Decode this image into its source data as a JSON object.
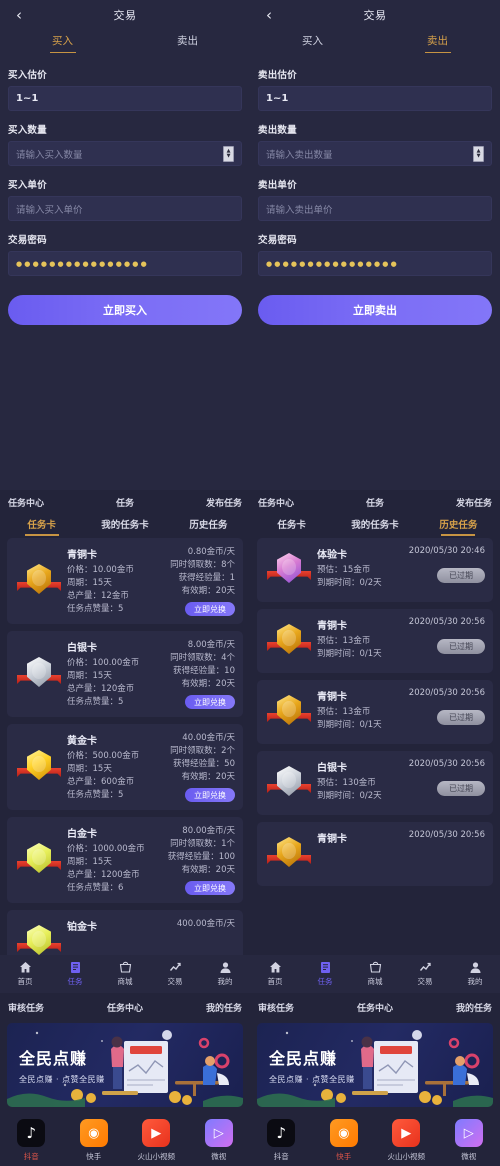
{
  "trade": {
    "buy": {
      "nav_back": "‹",
      "title": "交易",
      "tabs": [
        {
          "label": "买入",
          "active": true
        },
        {
          "label": "卖出",
          "active": false
        }
      ],
      "fields": [
        {
          "label": "买入估价",
          "value": "1~1",
          "placeholder": "",
          "type": "value"
        },
        {
          "label": "买入数量",
          "value": "",
          "placeholder": "请输入买入数量",
          "type": "number"
        },
        {
          "label": "买入单价",
          "value": "",
          "placeholder": "请输入买入单价",
          "type": "text"
        },
        {
          "label": "交易密码",
          "value": "●●●●●●●●●●●●●●●●",
          "placeholder": "",
          "type": "password"
        }
      ],
      "cta": "立即买入"
    },
    "sell": {
      "nav_back": "‹",
      "title": "交易",
      "tabs": [
        {
          "label": "买入",
          "active": false
        },
        {
          "label": "卖出",
          "active": true
        }
      ],
      "fields": [
        {
          "label": "卖出估价",
          "value": "1~1",
          "placeholder": "",
          "type": "value"
        },
        {
          "label": "卖出数量",
          "value": "",
          "placeholder": "请输入卖出数量",
          "type": "number"
        },
        {
          "label": "卖出单价",
          "value": "",
          "placeholder": "请输入卖出单价",
          "type": "text"
        },
        {
          "label": "交易密码",
          "value": "●●●●●●●●●●●●●●●●",
          "placeholder": "",
          "type": "password"
        }
      ],
      "cta": "立即卖出"
    }
  },
  "tasks_left": {
    "header": [
      "任务中心",
      "任务",
      "发布任务"
    ],
    "tabs": [
      {
        "label": "任务卡",
        "active": true
      },
      {
        "label": "我的任务卡",
        "active": false
      },
      {
        "label": "历史任务",
        "active": false
      }
    ],
    "cards": [
      {
        "badge": "b-bronze",
        "title": "青铜卡",
        "left": [
          "价格：10.00金币",
          "周期：15天",
          "总产量：12金币",
          "任务点赞量：5"
        ],
        "right": [
          "0.80金币/天",
          "同时领取数：8个",
          "获得经验量：1",
          "有效期：20天"
        ],
        "action": "立即兑换"
      },
      {
        "badge": "b-silver",
        "title": "白银卡",
        "left": [
          "价格：100.00金币",
          "周期：15天",
          "总产量：120金币",
          "任务点赞量：5"
        ],
        "right": [
          "8.00金币/天",
          "同时领取数：4个",
          "获得经验量：10",
          "有效期：20天"
        ],
        "action": "立即兑换"
      },
      {
        "badge": "b-gold",
        "title": "黄金卡",
        "left": [
          "价格：500.00金币",
          "周期：15天",
          "总产量：600金币",
          "任务点赞量：5"
        ],
        "right": [
          "40.00金币/天",
          "同时领取数：2个",
          "获得经验量：50",
          "有效期：20天"
        ],
        "action": "立即兑换"
      },
      {
        "badge": "b-plat",
        "title": "白金卡",
        "left": [
          "价格：1000.00金币",
          "周期：15天",
          "总产量：1200金币",
          "任务点赞量：6"
        ],
        "right": [
          "80.00金币/天",
          "同时领取数：1个",
          "获得经验量：100",
          "有效期：20天"
        ],
        "action": "立即兑换"
      },
      {
        "badge": "b-plat",
        "title": "铂金卡",
        "left": [],
        "right": [
          "400.00金币/天"
        ],
        "action": ""
      }
    ]
  },
  "tasks_right": {
    "header": [
      "任务中心",
      "任务",
      "发布任务"
    ],
    "tabs": [
      {
        "label": "任务卡",
        "active": false
      },
      {
        "label": "我的任务卡",
        "active": false
      },
      {
        "label": "历史任务",
        "active": true
      }
    ],
    "cards": [
      {
        "badge": "b-exp",
        "title": "体验卡",
        "timestamp": "2020/05/30 20:46",
        "left": [
          "预估：15金币",
          "到期时间：0/2天"
        ],
        "status": "已过期"
      },
      {
        "badge": "b-bronze",
        "title": "青铜卡",
        "timestamp": "2020/05/30 20:56",
        "left": [
          "预估：13金币",
          "到期时间：0/1天"
        ],
        "status": "已过期"
      },
      {
        "badge": "b-bronze",
        "title": "青铜卡",
        "timestamp": "2020/05/30 20:56",
        "left": [
          "预估：13金币",
          "到期时间：0/1天"
        ],
        "status": "已过期"
      },
      {
        "badge": "b-silver",
        "title": "白银卡",
        "timestamp": "2020/05/30 20:56",
        "left": [
          "预估：130金币",
          "到期时间：0/2天"
        ],
        "status": "已过期"
      },
      {
        "badge": "b-bronze",
        "title": "青铜卡",
        "timestamp": "2020/05/30 20:56",
        "left": [],
        "status": ""
      }
    ]
  },
  "bottom_nav": {
    "items": [
      {
        "label": "首页",
        "icon": "home-icon",
        "active": false
      },
      {
        "label": "任务",
        "icon": "task-icon",
        "active": true
      },
      {
        "label": "商城",
        "icon": "shop-icon",
        "active": false
      },
      {
        "label": "交易",
        "icon": "chart-icon",
        "active": false
      },
      {
        "label": "我的",
        "icon": "user-icon",
        "active": false
      }
    ]
  },
  "audit_header": [
    "审核任务",
    "任务中心",
    "我的任务"
  ],
  "banner": {
    "title": "全民点赚",
    "subtitle": "全民点赚 · 点赞全民赚"
  },
  "apps_left": [
    {
      "label": "抖音",
      "icon": "douyin-icon",
      "cls": "ic-douyin",
      "glyph": "♪",
      "active": true
    },
    {
      "label": "快手",
      "icon": "kuaishou-icon",
      "cls": "ic-kuaishou",
      "glyph": "◉",
      "active": false
    },
    {
      "label": "火山小视频",
      "icon": "huoshan-icon",
      "cls": "ic-huoshan",
      "glyph": "▶",
      "active": false
    },
    {
      "label": "微视",
      "icon": "weishi-icon",
      "cls": "ic-weishi",
      "glyph": "▷",
      "active": false
    }
  ],
  "apps_right": [
    {
      "label": "抖音",
      "icon": "douyin-icon",
      "cls": "ic-douyin",
      "glyph": "♪",
      "active": false
    },
    {
      "label": "快手",
      "icon": "kuaishou-icon",
      "cls": "ic-kuaishou",
      "glyph": "◉",
      "active": true
    },
    {
      "label": "火山小视频",
      "icon": "huoshan-icon",
      "cls": "ic-huoshan",
      "glyph": "▶",
      "active": false
    },
    {
      "label": "微视",
      "icon": "weishi-icon",
      "cls": "ic-weishi",
      "glyph": "▷",
      "active": false
    }
  ],
  "colors": {
    "bg": "#23243a",
    "panel": "#272840",
    "card": "#2a2b45",
    "accent_gold": "#d6a14a",
    "accent_purple": "#6f61f2",
    "text": "#e9eaf6"
  }
}
